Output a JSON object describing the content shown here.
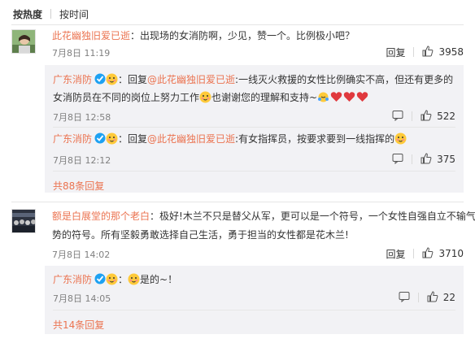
{
  "sort": {
    "hot": "按热度",
    "time": "按时间"
  },
  "icons": {
    "reply": "reply-icon",
    "like": "thumb-up-icon",
    "verified": "verified-badge-icon"
  },
  "colors": {
    "link": "#eb7350",
    "reply_bg": "#f2f2f5",
    "verified": "#1da1f2",
    "heart": "#e0393e"
  },
  "comments": [
    {
      "user": "此花幽独旧爱已逝",
      "sep": "：",
      "text": "出现场的女消防啊，少见，赞一个。比例极小吧？",
      "time": "7月8日 11:19",
      "reply_label": "回复",
      "likes": "3958",
      "replies": [
        {
          "user": "广东消防",
          "sep": "：回复",
          "mention": "@此花幽独旧爱已逝",
          "text1": ":一线灭火救援的女性比例确实不高，但还有更多的",
          "text2a": "女消防员在不同的岗位上努力工作",
          "text2b": "也谢谢您的理解和支持~",
          "time": "7月8日 12:58",
          "likes": "522"
        },
        {
          "user": "广东消防",
          "sep": "：回复",
          "mention": "@此花幽独旧爱已逝",
          "text1": ":有女指挥员，按要求要到一线指挥的",
          "time": "7月8日 12:12",
          "likes": "375"
        }
      ],
      "more": "共88条回复"
    },
    {
      "user": "额是白展堂的那个老白",
      "sep": "：",
      "text1": "极好!木兰不只是替父从军，更可以是一个符号，一个女性自强自立不输气",
      "text2": "势的符号。所有坚毅勇敢选择自己生活，勇于担当的女性都是花木兰!",
      "time": "7月8日 14:02",
      "reply_label": "回复",
      "likes": "3710",
      "replies": [
        {
          "user": "广东消防",
          "sep": "：",
          "text1": "是的~！",
          "time": "7月8日 14:05",
          "likes": "22"
        }
      ],
      "more": "共14条回复"
    }
  ]
}
